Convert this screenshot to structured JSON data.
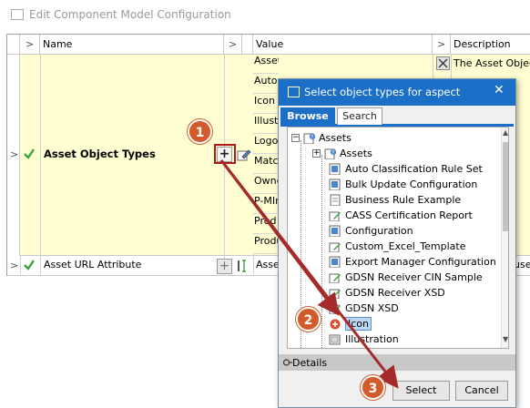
{
  "window": {
    "title": "Edit Component Model Configuration",
    "icon": "window-icon"
  },
  "columns": {
    "chevron": ">",
    "name": "Name",
    "value": "Value",
    "description": "Description"
  },
  "rows": [
    {
      "chevron": ">",
      "status": "checkmark",
      "name": "Asset Object Types",
      "values": [
        "Assets",
        "Auto",
        "Icon",
        "Illustr",
        "Logo",
        "Match",
        "Owne",
        "P-MIr",
        "Prod",
        "Produ"
      ],
      "description": "The Asset Object"
    },
    {
      "chevron": ">",
      "status": "checkmark",
      "name": "Asset URL Attribute",
      "values": [
        "Asset"
      ],
      "description": "used"
    }
  ],
  "dialog": {
    "title": "Select object types for aspect",
    "close": "✕",
    "tabs": [
      "Browse",
      "Search"
    ],
    "active_tab": "Browse",
    "tree": {
      "root": "Assets",
      "child_folder": "Assets",
      "items": [
        "Auto Classification Rule Set",
        "Bulk Update Configuration",
        "Business Rule Example",
        "CASS Certification Report",
        "Configuration",
        "Custom_Excel_Template",
        "Export Manager Configuration",
        "GDSN Receiver CIN Sample",
        "GDSN Receiver XSD",
        "GDSN XSD",
        "Icon",
        "Illustration"
      ],
      "selected": "Icon"
    },
    "details_label": "Details",
    "select_button": "Select",
    "cancel_button": "Cancel"
  },
  "callouts": [
    "1",
    "2",
    "3"
  ],
  "colors": {
    "accent_blue": "#1c6fc6",
    "row_highlight": "#fffed2",
    "callout": "#d35b2b",
    "arrow": "#a52a2a",
    "check": "#3aa33a"
  }
}
